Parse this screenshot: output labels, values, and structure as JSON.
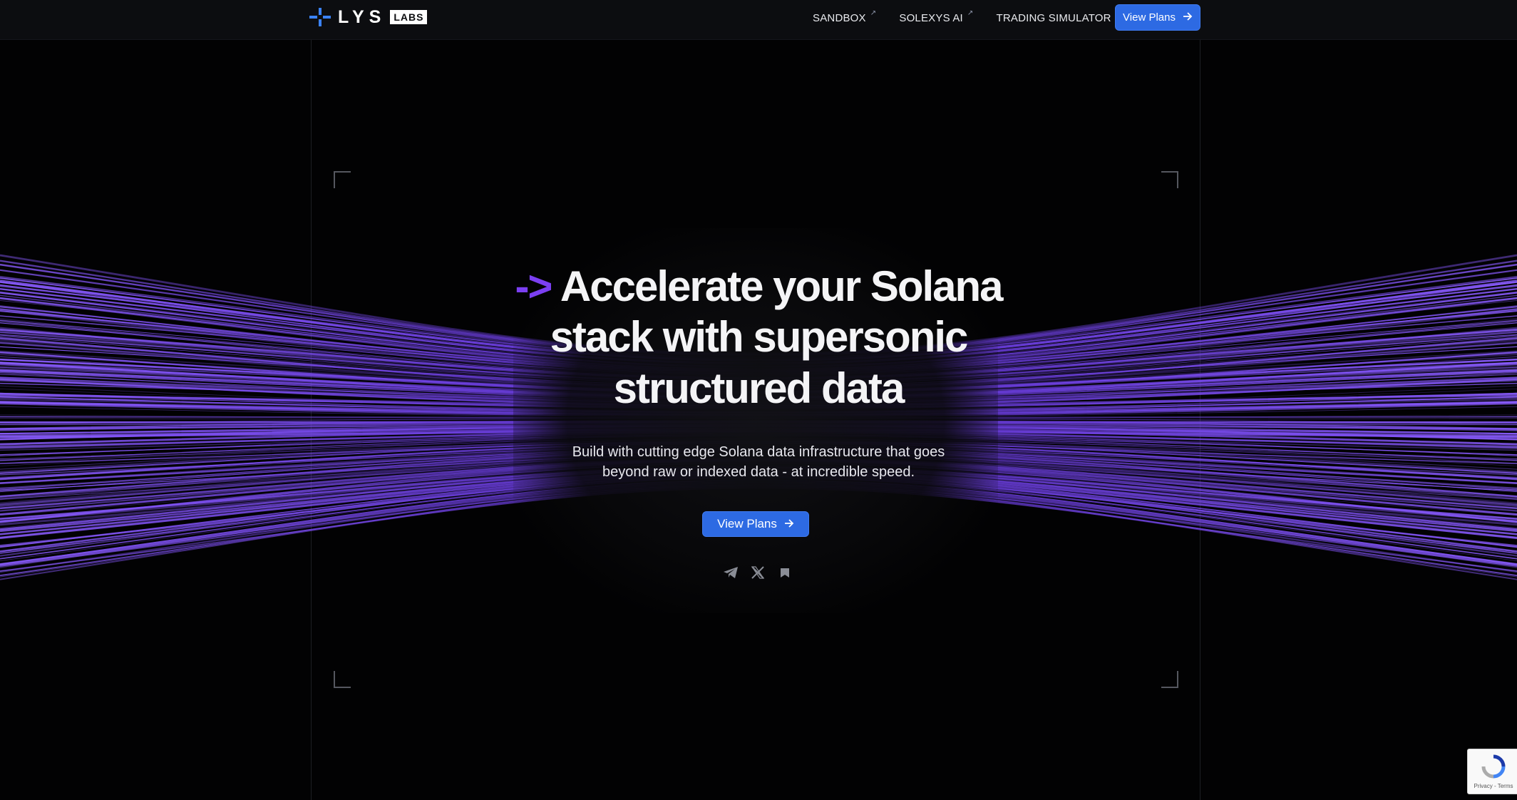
{
  "nav": {
    "logo_word": "LYS",
    "logo_badge": "LABS",
    "links": [
      {
        "label": "SANDBOX",
        "icon": "external-arrow-icon"
      },
      {
        "label": "SOLEXYS AI",
        "icon": "external-arrow-icon"
      },
      {
        "label": "TRADING SIMULATOR",
        "icon": "external-arrow-icon"
      }
    ],
    "external_glyph": "↗",
    "cta_label": "View Plans",
    "cta_icon": "arrow-right-icon"
  },
  "hero": {
    "arrow_prefix": "->",
    "headline_line1": "Accelerate your Solana",
    "headline_line2": "stack with supersonic",
    "headline_line3": "structured data",
    "subtitle_line1": "Build with cutting edge Solana data infrastructure that goes",
    "subtitle_line2": "beyond raw or indexed data - at incredible speed.",
    "cta_label": "View Plans",
    "socials": [
      "telegram-icon",
      "x-icon",
      "bookmark-icon"
    ]
  },
  "recaptcha": {
    "links": "Privacy - Terms"
  },
  "colors": {
    "background": "#020203",
    "navbar": "#0c0d10",
    "accent_purple": "#7b3ff2",
    "button_blue": "#2d6ae3",
    "logo_blue": "#3b82f6"
  }
}
